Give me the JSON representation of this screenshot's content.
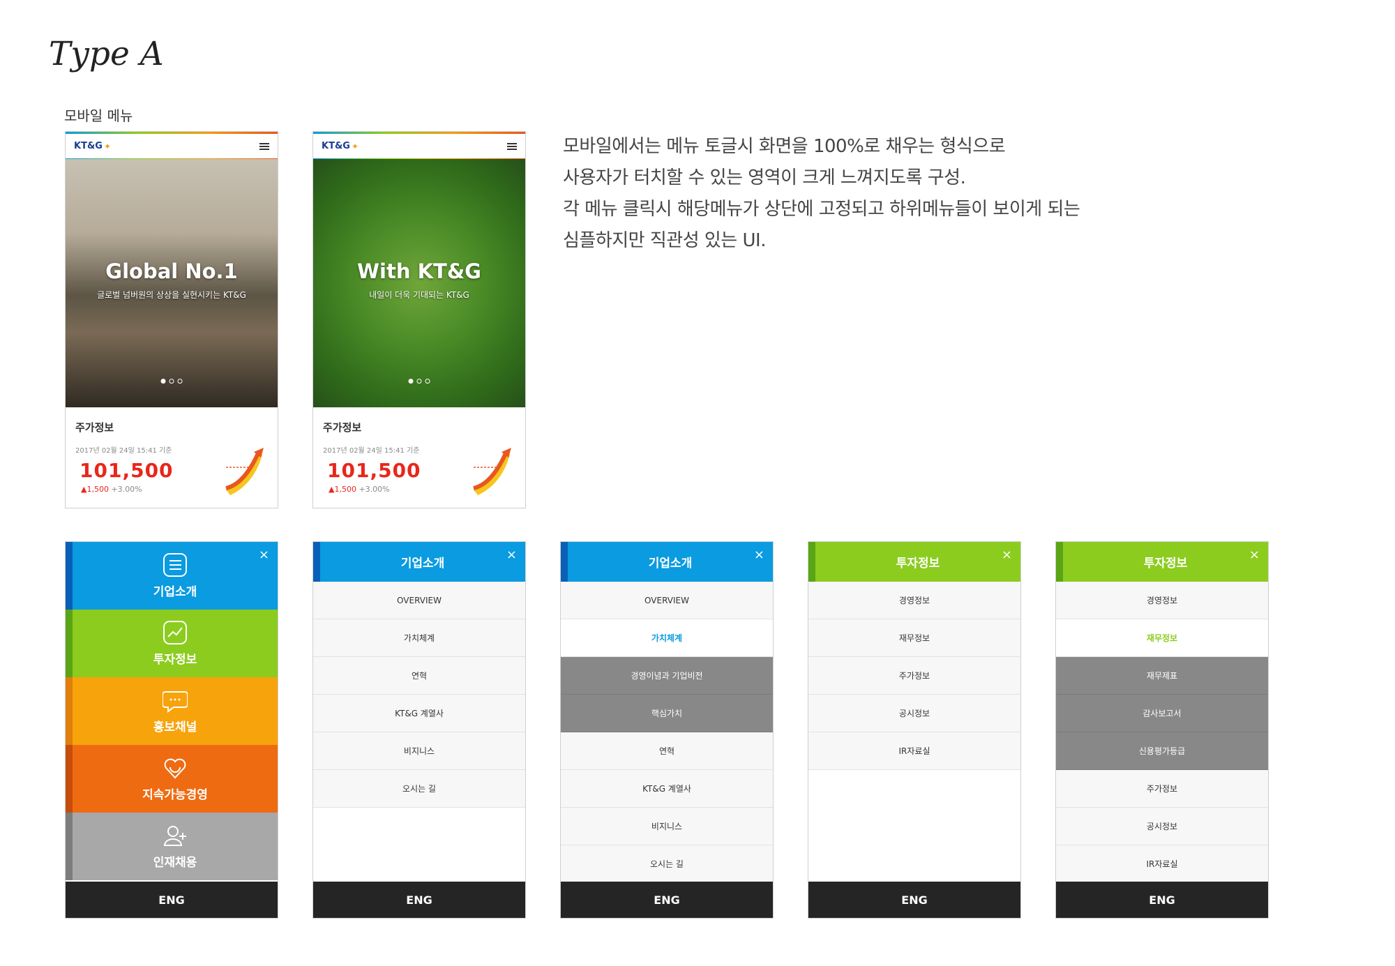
{
  "page": {
    "title": "Type A",
    "section_label": "모바일 메뉴",
    "description": [
      "모바일에서는 메뉴 토글시 화면을 100%로 채우는 형식으로",
      "사용자가 터치할 수 있는 영역이 크게 느껴지도록 구성.",
      "각 메뉴 클릭시 해당메뉴가 상단에 고정되고 하위메뉴들이 보이게 되는",
      "심플하지만 직관성 있는 UI."
    ]
  },
  "phones": [
    {
      "logo": "KT&G",
      "hero_title": "Global No.1",
      "hero_sub": "글로벌 넘버원의 상상을 실현시키는 KT&G",
      "stock_title": "주가정보",
      "stock_time": "2017년 02월 24일 15:41 기준",
      "stock_price": "101,500",
      "stock_change": "▲1,500",
      "stock_pct": "+3.00%"
    },
    {
      "logo": "KT&G",
      "hero_title": "With KT&G",
      "hero_sub": "내일이 더욱 기대되는 KT&G",
      "stock_title": "주가정보",
      "stock_time": "2017년 02월 24일 15:41 기준",
      "stock_price": "101,500",
      "stock_change": "▲1,500",
      "stock_pct": "+3.00%"
    }
  ],
  "menu_tiles": {
    "close": "×",
    "items": [
      "기업소개",
      "투자정보",
      "홍보채널",
      "지속가능경영",
      "인재채용"
    ],
    "footer": "ENG"
  },
  "menu2": {
    "header": "기업소개",
    "close": "×",
    "items": [
      "OVERVIEW",
      "가치체계",
      "연혁",
      "KT&G 계열사",
      "비지니스",
      "오시는 길"
    ],
    "footer": "ENG"
  },
  "menu3": {
    "header": "기업소개",
    "close": "×",
    "items": [
      "OVERVIEW",
      "가치체계",
      "경영이념과 기업비전",
      "핵심가치",
      "연혁",
      "KT&G 계열사",
      "비지니스",
      "오시는 길"
    ],
    "footer": "ENG"
  },
  "menu4": {
    "header": "투자정보",
    "close": "×",
    "items": [
      "경영정보",
      "재무정보",
      "주가정보",
      "공시정보",
      "IR자료실"
    ],
    "footer": "ENG"
  },
  "menu5": {
    "header": "투자정보",
    "close": "×",
    "items": [
      "경영정보",
      "재무정보",
      "재무제표",
      "감사보고서",
      "신용평가등급",
      "주가정보",
      "공시정보",
      "IR자료실"
    ],
    "footer": "ENG"
  },
  "colors": {
    "blue": "#0a9be0",
    "green": "#8ccc1f",
    "orange": "#f7a30c",
    "red_orange": "#ef6b12",
    "gray": "#a8a8a8",
    "price_red": "#e8261b"
  }
}
